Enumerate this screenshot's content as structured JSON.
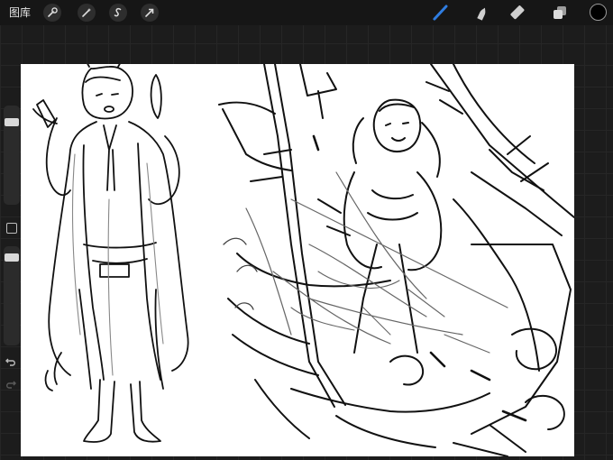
{
  "topbar": {
    "gallery_label": "图库",
    "actions": [
      "wrench-icon",
      "magic-wand-icon",
      "selection-s-icon",
      "transform-arrow-icon"
    ],
    "tools": [
      "brush-icon",
      "smudge-icon",
      "eraser-icon",
      "layers-icon"
    ],
    "active_tool": "brush-icon",
    "active_tool_color": "#2f7de1",
    "current_color": "#000000"
  },
  "sidebar": {
    "brush_size_level": 0.12,
    "opacity_level": 0.05
  }
}
